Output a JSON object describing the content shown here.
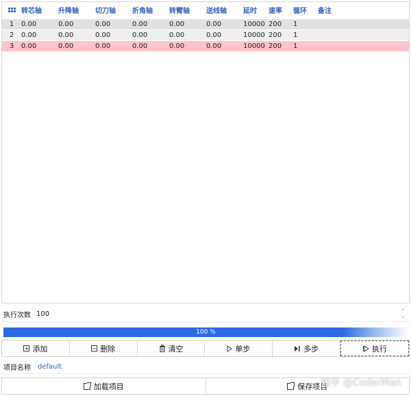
{
  "grid": {
    "columns": [
      "转芯轴",
      "升降轴",
      "切刀轴",
      "折角轴",
      "转臂轴",
      "送线轴",
      "延时",
      "速率",
      "循环",
      "备注"
    ],
    "rows": [
      {
        "index": "1",
        "cells": [
          "0.00",
          "0.00",
          "0.00",
          "0.00",
          "0.00",
          "0.00",
          "10000",
          "200",
          "1",
          ""
        ]
      },
      {
        "index": "2",
        "cells": [
          "0.00",
          "0.00",
          "0.00",
          "0.00",
          "0.00",
          "0.00",
          "10000",
          "200",
          "1",
          ""
        ]
      },
      {
        "index": "3",
        "cells": [
          "0.00",
          "0.00",
          "0.00",
          "0.00",
          "0.00",
          "0.00",
          "10000",
          "200",
          "1",
          ""
        ]
      }
    ],
    "selected_row_color": "#ffc3cc"
  },
  "exec": {
    "label": "执行次数",
    "value": "100"
  },
  "progress": {
    "text": "100 %",
    "value": 1.0,
    "color": "#2e6be0"
  },
  "toolbar": {
    "add_label": "添加",
    "delete_label": "删除",
    "clear_label": "清空",
    "step_label": "单步",
    "multi_label": "多步",
    "run_label": "执行"
  },
  "project": {
    "label": "项目名称",
    "value": "default"
  },
  "bottom": {
    "load_label": "加载项目",
    "save_label": "保存项目"
  },
  "watermark": "知乎 @CoderMan"
}
